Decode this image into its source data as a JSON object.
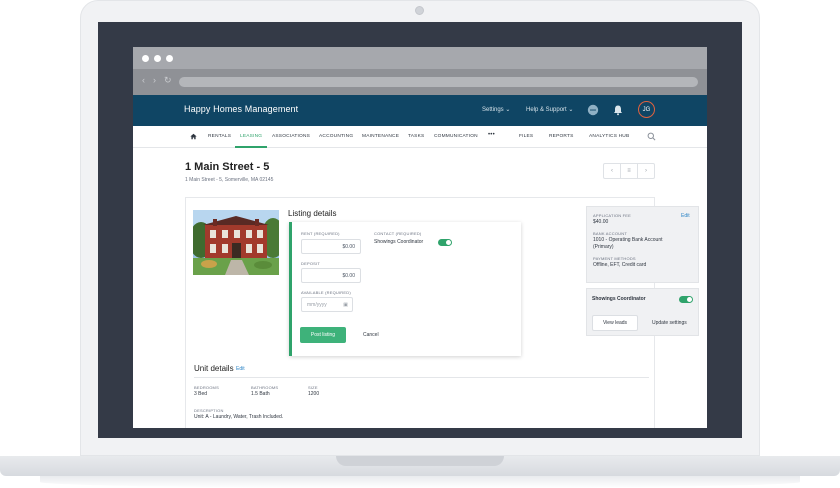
{
  "app": {
    "brand": "Happy Homes Management",
    "settings_menu": "Settings ⌄",
    "help_menu": "Help & Support ⌄",
    "user_initials": "JG"
  },
  "nav": {
    "items": [
      "RENTALS",
      "LEASING",
      "ASSOCIATIONS",
      "ACCOUNTING",
      "MAINTENANCE",
      "TASKS",
      "COMMUNICATION",
      "•••",
      "FILES",
      "REPORTS",
      "ANALYTICS HUB"
    ],
    "active": "LEASING"
  },
  "property": {
    "title": "1 Main Street - 5",
    "address": "1 Main Street - 5, Somerville, MA 02145"
  },
  "listing": {
    "heading": "Listing details",
    "rent_label": "RENT (REQUIRED)",
    "rent_value": "$0.00",
    "deposit_label": "DEPOSIT",
    "deposit_value": "$0.00",
    "available_label": "AVAILABLE (REQUIRED)",
    "available_placeholder": "mm/yyyy",
    "contact_label": "CONTACT (REQUIRED)",
    "contact_value": "Showings Coordinator",
    "post_button": "Post listing",
    "cancel_button": "Cancel"
  },
  "side": {
    "app_fee_label": "APPLICATION FEE",
    "app_fee_value": "$40.00",
    "edit": "Edit",
    "bank_label": "BANK ACCOUNT",
    "bank_value_1": "1010 - Operating Bank Account",
    "bank_value_2": "(Primary)",
    "payment_label": "PAYMENT METHODS",
    "payment_value": "Offline, EFT, Credit card",
    "showings_title": "Showings Coordinator",
    "view_leads": "View leads",
    "update_settings": "Update settings"
  },
  "unit": {
    "heading": "Unit details",
    "edit": "Edit",
    "bedrooms_label": "BEDROOMS",
    "bedrooms_value": "3 Bed",
    "bathrooms_label": "BATHROOMS",
    "bathrooms_value": "1.5 Bath",
    "size_label": "SIZE",
    "size_value": "1200",
    "description_label": "DESCRIPTION",
    "description_value": "Unit: A - Laundry, Water, Trash Included."
  },
  "colors": {
    "header": "#0f4564",
    "accent_green": "#2fa36b",
    "link_blue": "#2b84c6",
    "avatar_ring": "#e0623f"
  }
}
